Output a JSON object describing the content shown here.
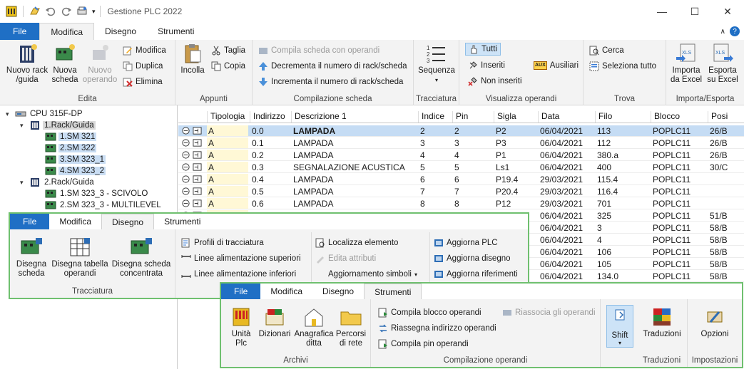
{
  "window": {
    "title": "Gestione PLC 2022",
    "minimize": "—",
    "maximize": "☐",
    "close": "✕"
  },
  "tabs": [
    "File",
    "Modifica",
    "Disegno",
    "Strumenti"
  ],
  "ribbon": {
    "edita": {
      "label": "Edita",
      "nuovo_rack": "Nuovo rack\n/guida",
      "nuova_scheda": "Nuova\nscheda",
      "nuovo_operando": "Nuovo\noperando",
      "modifica": "Modifica",
      "duplica": "Duplica",
      "elimina": "Elimina"
    },
    "appunti": {
      "label": "Appunti",
      "incolla": "Incolla",
      "taglia": "Taglia",
      "copia": "Copia"
    },
    "compilazione": {
      "label": "Compilazione scheda",
      "compila": "Compila scheda con operandi",
      "decrementa": "Decrementa il numero di rack/scheda",
      "incrementa": "Incrementa il numero di rack/scheda"
    },
    "tracciatura": {
      "label": "Tracciatura",
      "sequenza": "Sequenza"
    },
    "visualizza": {
      "label": "Visualizza operandi",
      "tutti": "Tutti",
      "inseriti": "Inseriti",
      "non_inseriti": "Non inseriti",
      "ausiliari": "Ausiliari",
      "aux": "AUX"
    },
    "trova": {
      "label": "Trova",
      "cerca": "Cerca",
      "seleziona": "Seleziona tutto"
    },
    "importa": {
      "label": "Importa/Esporta",
      "importa": "Importa\nda Excel",
      "esporta": "Esporta\nsu Excel",
      "xls": "XLS"
    }
  },
  "tree": [
    {
      "label": "CPU 315F-DP",
      "level": 0,
      "exp": "▾",
      "style": ""
    },
    {
      "label": "1.Rack/Guida",
      "level": 1,
      "exp": "▾",
      "style": "gray"
    },
    {
      "label": "1.SM 321",
      "level": 2,
      "exp": "",
      "style": "hl"
    },
    {
      "label": "2.SM 322",
      "level": 2,
      "exp": "",
      "style": "hl"
    },
    {
      "label": "3.SM 323_1",
      "level": 2,
      "exp": "",
      "style": "hl"
    },
    {
      "label": "4.SM 323_2",
      "level": 2,
      "exp": "",
      "style": "hl"
    },
    {
      "label": "2.Rack/Guida",
      "level": 1,
      "exp": "▾",
      "style": ""
    },
    {
      "label": "1.SM 323_3 - SCIVOLO",
      "level": 2,
      "exp": "",
      "style": ""
    },
    {
      "label": "2.SM 323_3 - MULTILEVEL",
      "level": 2,
      "exp": "",
      "style": ""
    }
  ],
  "grid": {
    "headers": [
      "Tipologia",
      "Indirizzo",
      "Descrizione 1",
      "Indice",
      "Pin",
      "Sigla",
      "Data",
      "Filo",
      "Blocco",
      "Posi"
    ],
    "rows": [
      [
        "A",
        "0.0",
        "LAMPADA",
        "2",
        "2",
        "P2",
        "06/04/2021",
        "113",
        "POPLC11",
        "26/B"
      ],
      [
        "A",
        "0.1",
        "LAMPADA",
        "3",
        "3",
        "P3",
        "06/04/2021",
        "112",
        "POPLC11",
        "26/B"
      ],
      [
        "A",
        "0.2",
        "LAMPADA",
        "4",
        "4",
        "P1",
        "06/04/2021",
        "380.a",
        "POPLC11",
        "26/B"
      ],
      [
        "A",
        "0.3",
        "SEGNALAZIONE ACUSTICA",
        "5",
        "5",
        "Ls1",
        "06/04/2021",
        "400",
        "POPLC11",
        "30/C"
      ],
      [
        "A",
        "0.4",
        "LAMPADA",
        "6",
        "6",
        "P19.4",
        "29/03/2021",
        "115.4",
        "POPLC11",
        ""
      ],
      [
        "A",
        "0.5",
        "LAMPADA",
        "7",
        "7",
        "P20.4",
        "29/03/2021",
        "116.4",
        "POPLC11",
        ""
      ],
      [
        "A",
        "0.6",
        "LAMPADA",
        "8",
        "8",
        "P12",
        "29/03/2021",
        "701",
        "POPLC11",
        ""
      ],
      [
        "",
        "",
        "",
        "",
        "",
        "",
        "06/04/2021",
        "325",
        "POPLC11",
        "51/B"
      ],
      [
        "",
        "",
        "",
        "",
        "",
        "",
        "06/04/2021",
        "3",
        "POPLC11",
        "58/B"
      ],
      [
        "",
        "",
        "",
        "",
        "",
        "",
        "06/04/2021",
        "4",
        "POPLC11",
        "58/B"
      ],
      [
        "",
        "",
        "",
        "",
        "",
        "",
        "06/04/2021",
        "106",
        "POPLC11",
        "58/B"
      ],
      [
        "",
        "",
        "",
        "",
        "",
        "",
        "06/04/2021",
        "105",
        "POPLC11",
        "58/B"
      ],
      [
        "",
        "",
        "",
        "",
        "",
        "",
        "06/04/2021",
        "134.0",
        "POPLC11",
        "58/B"
      ]
    ]
  },
  "popup_disegno": {
    "tabs": [
      "File",
      "Modifica",
      "Disegno",
      "Strumenti"
    ],
    "disegna_scheda": "Disegna\nscheda",
    "disegna_tabella": "Disegna tabella\noperandi",
    "disegna_concentrata": "Disegna scheda\nconcentrata",
    "group_label": "Tracciatura",
    "profili": "Profili di tracciatura",
    "linee_sup": "Linee alimentazione superiori",
    "linee_inf": "Linee alimentazione inferiori",
    "localizza": "Localizza elemento",
    "edita_attributi": "Edita attributi",
    "aggiornamento": "Aggiornamento simboli",
    "aggiorna_plc": "Aggiorna PLC",
    "aggiorna_disegno": "Aggiorna disegno",
    "aggiorna_riferimenti": "Aggiorna riferimenti"
  },
  "popup_strumenti": {
    "tabs": [
      "File",
      "Modifica",
      "Disegno",
      "Strumenti"
    ],
    "unita": "Unità\nPlc",
    "dizionari": "Dizionari",
    "anagrafica": "Anagrafica\nditta",
    "percorsi": "Percorsi\ndi rete",
    "archivi": "Archivi",
    "compila_blocco": "Compila blocco operandi",
    "riassegna": "Riassegna indirizzo operandi",
    "compila_pin": "Compila pin operandi",
    "riassocia": "Riassocia gli operandi",
    "compilazione_label": "Compilazione operandi",
    "shift": "Shift",
    "traduzioni": "Traduzioni",
    "traduzioni_label": "Traduzioni",
    "opzioni": "Opzioni",
    "impostazioni": "Impostazioni"
  }
}
